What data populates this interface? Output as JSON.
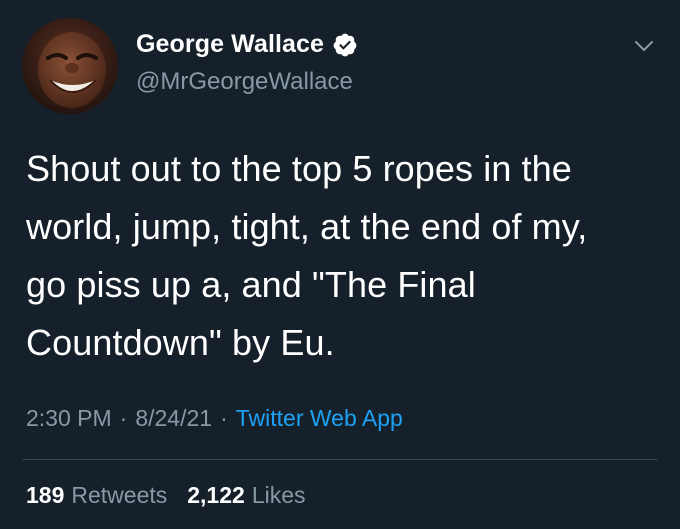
{
  "user": {
    "display_name": "George Wallace",
    "handle": "@MrGeorgeWallace",
    "verified": true,
    "avatar_icon": "profile-photo"
  },
  "tweet": {
    "text": "Shout out to the top 5 ropes in the\nworld, jump, tight, at the end of my,\ngo piss up a, and \"The Final\nCountdown\" by Eu."
  },
  "meta": {
    "time": "2:30 PM",
    "separator": "·",
    "date": "8/24/21",
    "source": "Twitter Web App"
  },
  "stats": {
    "retweets_count": "189",
    "retweets_label": "Retweets",
    "likes_count": "2,122",
    "likes_label": "Likes"
  },
  "colors": {
    "background": "#15202b",
    "primary_text": "#ffffff",
    "secondary_text": "#8899a6",
    "link": "#1da1f2",
    "divider": "#38444d"
  }
}
